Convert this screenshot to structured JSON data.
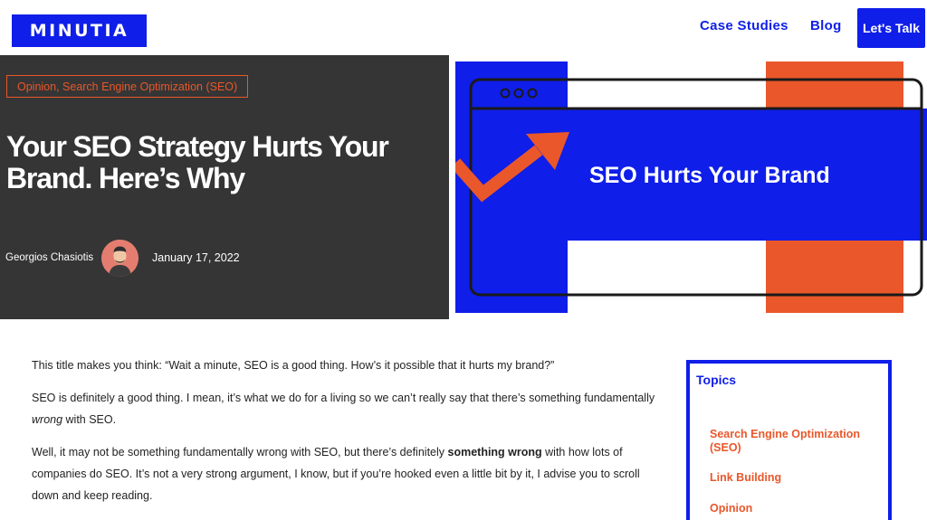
{
  "header": {
    "logo": "MINUTIA",
    "nav": [
      "Case Studies",
      "Blog"
    ],
    "cta": "Let's Talk"
  },
  "hero": {
    "category": "Opinion, Search Engine Optimization (SEO)",
    "title": "Your SEO Strategy Hurts Your Brand. Here’s Why",
    "author": "Georgios Chasiotis",
    "date": "January 17, 2022",
    "image_text": "SEO Hurts Your Brand"
  },
  "article": {
    "p1": "This title makes you think: “Wait a minute, SEO is a good thing. How’s it possible that it hurts my brand?”",
    "p2_a": "SEO is definitely a good thing. I mean, it’s what we do for a living so we can’t really say that there’s something fundamentally ",
    "p2_em": "wrong",
    "p2_b": " with SEO.",
    "p3_a": "Well, it may not be something fundamentally wrong with SEO, but there’s definitely ",
    "p3_strong": "something wrong",
    "p3_b": " with how lots of companies do SEO. It’s not a very strong argument, I know, but if you’re hooked even a little bit by it, I advise you to scroll down and keep reading."
  },
  "sidebar": {
    "title": "Topics",
    "topics": [
      "Search Engine Optimization (SEO)",
      "Link Building",
      "Opinion"
    ]
  },
  "colors": {
    "brand_blue": "#0f1ee8",
    "accent_orange": "#e9572a",
    "hero_dark": "#353535"
  }
}
